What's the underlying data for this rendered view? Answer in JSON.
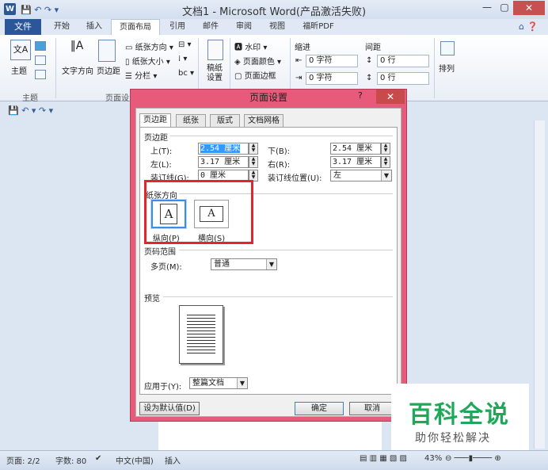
{
  "window": {
    "title": "文档1 - Microsoft Word(产品激活失败)",
    "app_icon": "W",
    "minimize": "—",
    "restore": "▢",
    "close": "✕",
    "help": "⌂ ❓"
  },
  "ribbon_tabs": [
    "文件",
    "开始",
    "插入",
    "页面布局",
    "引用",
    "邮件",
    "审阅",
    "视图",
    "福昕PDF"
  ],
  "ribbon": {
    "theme": {
      "label": "主题",
      "group": "主题"
    },
    "text_dir": "文字方向",
    "margins": "页边距",
    "page_setup_group": "页面设置",
    "orientation": "纸张方向 ▾",
    "size": "纸张大小 ▾",
    "columns": "分栏 ▾",
    "draft_paper": "稿纸\n设置",
    "watermark": "水印 ▾",
    "page_color": "页面颜色 ▾",
    "page_border": "页面边框",
    "indent": {
      "title": "缩进",
      "left": "0 字符",
      "right": "0 字符"
    },
    "spacing": {
      "title": "间距",
      "before": "0 行",
      "after": "0 行"
    },
    "arrange": "排列"
  },
  "dialog": {
    "title": "页面设置",
    "help": "?",
    "close": "✕",
    "tabs": [
      "页边距",
      "纸张",
      "版式",
      "文档网格"
    ],
    "margins_section": "页边距",
    "top_label": "上(T):",
    "top_value": "2.54 厘米",
    "bottom_label": "下(B):",
    "bottom_value": "2.54 厘米",
    "left_label": "左(L):",
    "left_value": "3.17 厘米",
    "right_label": "右(R):",
    "right_value": "3.17 厘米",
    "gutter_label": "装订线(G):",
    "gutter_value": "0 厘米",
    "gutter_pos_label": "装订线位置(U):",
    "gutter_pos_value": "左",
    "orientation_section": "纸张方向",
    "portrait": "纵向(P)",
    "landscape": "横向(S)",
    "pages_section": "页码范围",
    "multiple_label": "多页(M):",
    "multiple_value": "普通",
    "preview_section": "预览",
    "apply_label": "应用于(Y):",
    "apply_value": "整篇文档",
    "default_button": "设为默认值(D)",
    "ok_button": "确定",
    "cancel_button": "取消"
  },
  "status": {
    "page": "页面: 2/2",
    "words": "字数: 80",
    "lang": "中文(中国)",
    "mode": "插入",
    "zoom": "43%"
  },
  "watermark": {
    "line1": "百科全说",
    "line2": "助你轻松解决"
  },
  "colors": {
    "accent": "#2b579a",
    "dialog_frame": "#e85a7a",
    "highlight": "#e3262e",
    "watermark_green": "#1fa85a"
  }
}
